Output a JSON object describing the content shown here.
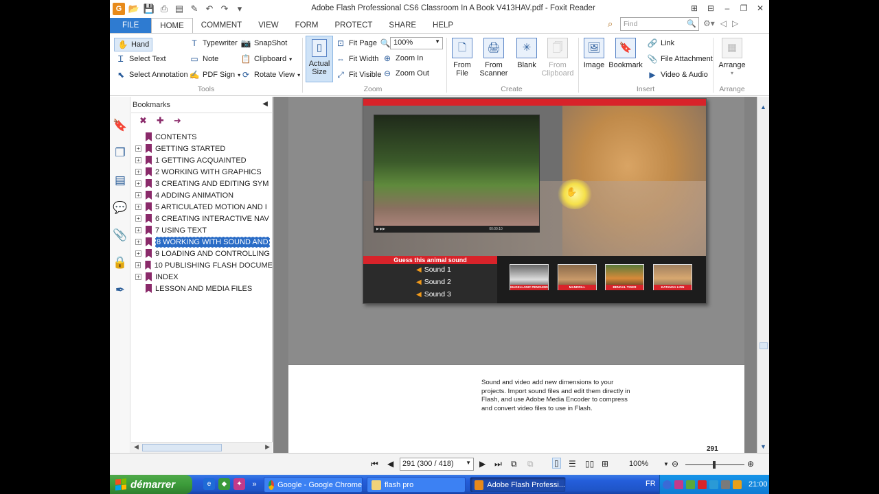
{
  "window": {
    "title": "Adobe Flash Professional CS6 Classroom In A Book V413HAV.pdf - Foxit Reader"
  },
  "tabs": [
    "FILE",
    "HOME",
    "COMMENT",
    "VIEW",
    "FORM",
    "PROTECT",
    "SHARE",
    "HELP"
  ],
  "active_tab": "HOME",
  "find": {
    "placeholder": "Find"
  },
  "ribbon": {
    "tools": {
      "label": "Tools",
      "hand": "Hand",
      "select_text": "Select Text",
      "select_annotation": "Select Annotation",
      "typewriter": "Typewriter",
      "note": "Note",
      "pdf_sign": "PDF Sign",
      "snapshot": "SnapShot",
      "clipboard": "Clipboard",
      "rotate_view": "Rotate View"
    },
    "zoom": {
      "label": "Zoom",
      "actual_size_1": "Actual",
      "actual_size_2": "Size",
      "fit_page": "Fit Page",
      "fit_width": "Fit Width",
      "fit_visible": "Fit Visible",
      "zoom_value": "100%",
      "zoom_in": "Zoom In",
      "zoom_out": "Zoom Out"
    },
    "create": {
      "label": "Create",
      "from_file_1": "From",
      "from_file_2": "File",
      "from_scanner_1": "From",
      "from_scanner_2": "Scanner",
      "blank": "Blank",
      "from_clipboard_1": "From",
      "from_clipboard_2": "Clipboard"
    },
    "insert": {
      "label": "Insert",
      "image": "Image",
      "bookmark": "Bookmark",
      "link": "Link",
      "file_attachment": "File Attachment",
      "video_audio": "Video & Audio"
    },
    "arrange": {
      "label": "Arrange",
      "arrange": "Arrange"
    }
  },
  "bookmarks": {
    "title": "Bookmarks",
    "items": [
      {
        "label": "CONTENTS",
        "expandable": false
      },
      {
        "label": "GETTING STARTED",
        "expandable": true
      },
      {
        "label": "1 GETTING ACQUAINTED",
        "expandable": true
      },
      {
        "label": "2 WORKING WITH GRAPHICS",
        "expandable": true
      },
      {
        "label": "3 CREATING AND EDITING SYM",
        "expandable": true
      },
      {
        "label": "4 ADDING ANIMATION",
        "expandable": true
      },
      {
        "label": "5 ARTICULATED MOTION AND I",
        "expandable": true
      },
      {
        "label": "6 CREATING INTERACTIVE NAV",
        "expandable": true
      },
      {
        "label": "7 USING TEXT",
        "expandable": true
      },
      {
        "label": "8 WORKING WITH SOUND AND",
        "expandable": true,
        "selected": true
      },
      {
        "label": "9 LOADING AND CONTROLLING",
        "expandable": true
      },
      {
        "label": "10 PUBLISHING FLASH DOCUME",
        "expandable": true
      },
      {
        "label": "INDEX",
        "expandable": true
      },
      {
        "label": "LESSON AND MEDIA FILES",
        "expandable": false
      }
    ]
  },
  "document": {
    "flash_demo": {
      "guess_title": "Guess this animal sound",
      "sounds": [
        "Sound 1",
        "Sound 2",
        "Sound 3"
      ],
      "video_time": "00:00:10",
      "thumbnails": [
        "MAGELLANIC PENGUINS",
        "MANDRILL",
        "BENGAL TIGER",
        "KATANGA LION"
      ]
    },
    "paragraph": "Sound and video add new dimensions to your projects. Import sound files and edit them directly in Flash, and use Adobe Media Encoder to compress and convert video files to use in Flash.",
    "page_number": "291"
  },
  "statusbar": {
    "page_box": "291 (300 / 418)",
    "zoom": "100%"
  },
  "taskbar": {
    "start": "démarrer",
    "tasks": [
      "Google - Google Chrome",
      "flash pro",
      "Adobe Flash Professi..."
    ],
    "language": "FR",
    "clock": "21:00"
  },
  "colors": {
    "accent_blue": "#2e7bd1",
    "bookmark_flag": "#8a2a6a",
    "flash_red": "#d8232a",
    "taskbar_blue": "#245edb"
  }
}
